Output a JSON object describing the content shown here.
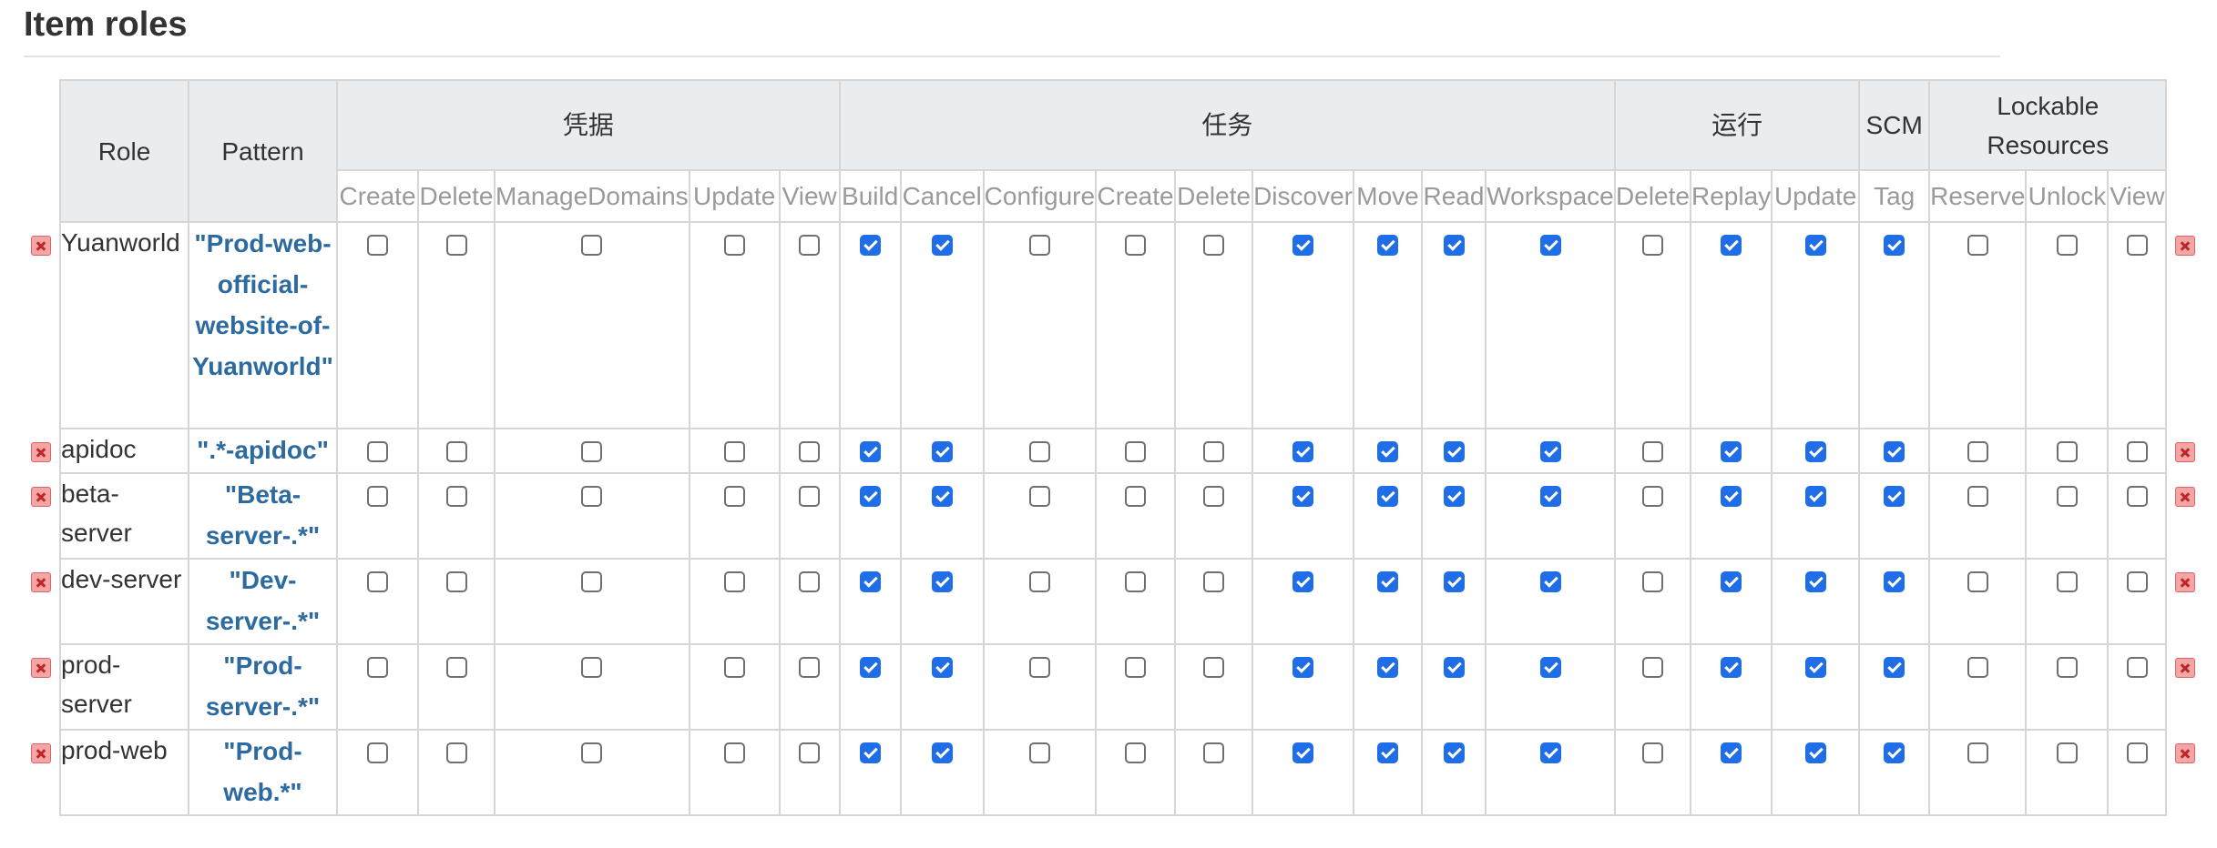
{
  "section": {
    "title": "Item roles"
  },
  "table": {
    "role_header": "Role",
    "pattern_header": "Pattern",
    "groups": [
      {
        "label": "凭据",
        "span": 5
      },
      {
        "label": "任务",
        "span": 9
      },
      {
        "label": "运行",
        "span": 3
      },
      {
        "label": "SCM",
        "span": 1
      },
      {
        "label": "Lockable Resources",
        "span": 3
      }
    ],
    "permissions": [
      "Create",
      "Delete",
      "ManageDomains",
      "Update",
      "View",
      "Build",
      "Cancel",
      "Configure",
      "Create",
      "Delete",
      "Discover",
      "Move",
      "Read",
      "Workspace",
      "Delete",
      "Replay",
      "Update",
      "Tag",
      "Reserve",
      "Unlock",
      "View"
    ],
    "rows": [
      {
        "role": "Yuanworld",
        "pattern": "\"Prod-web-official-website-of-Yuanworld\"",
        "checks": [
          false,
          false,
          false,
          false,
          false,
          true,
          true,
          false,
          false,
          false,
          true,
          true,
          true,
          true,
          false,
          true,
          true,
          true,
          false,
          false,
          false
        ]
      },
      {
        "role": "apidoc",
        "pattern": "\".*-apidoc\"",
        "checks": [
          false,
          false,
          false,
          false,
          false,
          true,
          true,
          false,
          false,
          false,
          true,
          true,
          true,
          true,
          false,
          true,
          true,
          true,
          false,
          false,
          false
        ]
      },
      {
        "role": "beta-server",
        "pattern": "\"Beta-server-.*\"",
        "checks": [
          false,
          false,
          false,
          false,
          false,
          true,
          true,
          false,
          false,
          false,
          true,
          true,
          true,
          true,
          false,
          true,
          true,
          true,
          false,
          false,
          false
        ]
      },
      {
        "role": "dev-server",
        "pattern": "\"Dev-server-.*\"",
        "checks": [
          false,
          false,
          false,
          false,
          false,
          true,
          true,
          false,
          false,
          false,
          true,
          true,
          true,
          true,
          false,
          true,
          true,
          true,
          false,
          false,
          false
        ]
      },
      {
        "role": "prod-server",
        "pattern": "\"Prod-server-.*\"",
        "checks": [
          false,
          false,
          false,
          false,
          false,
          true,
          true,
          false,
          false,
          false,
          true,
          true,
          true,
          true,
          false,
          true,
          true,
          true,
          false,
          false,
          false
        ]
      },
      {
        "role": "prod-web",
        "pattern": "\"Prod-web.*\"",
        "checks": [
          false,
          false,
          false,
          false,
          false,
          true,
          true,
          false,
          false,
          false,
          true,
          true,
          true,
          true,
          false,
          true,
          true,
          true,
          false,
          false,
          false
        ]
      }
    ]
  },
  "icons": {
    "delete_row": "delete-x-icon"
  },
  "colors": {
    "checked": "#1f6ee8",
    "pattern_text": "#2c6aa0",
    "header_bg": "#eaedef",
    "delete_icon": "#e06262"
  }
}
